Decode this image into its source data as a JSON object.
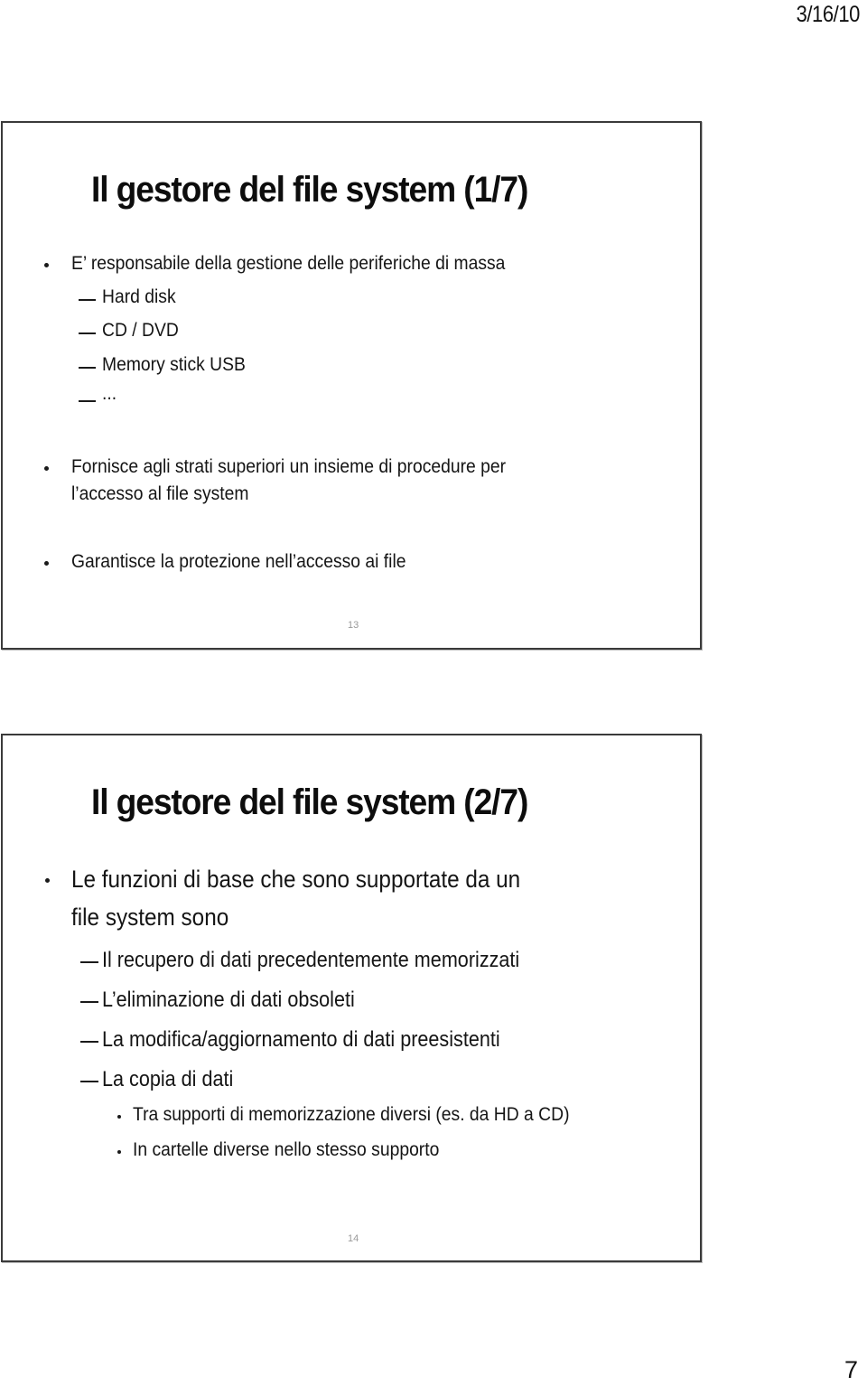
{
  "page": {
    "date": "3/16/10",
    "page_number": "7"
  },
  "slides": [
    {
      "number": "13",
      "title": "Il gestore del file system (1/7)",
      "bullets": [
        {
          "text": "E’ responsabile della gestione delle periferiche di massa",
          "sub": [
            "Hard disk",
            "CD / DVD",
            "Memory stick USB",
            "..."
          ]
        },
        {
          "text_lines": [
            "Fornisce agli strati superiori un insieme di procedure per",
            "l’accesso al file system"
          ]
        },
        {
          "text": "Garantisce la protezione nell’accesso ai file"
        }
      ]
    },
    {
      "number": "14",
      "title": "Il gestore del file system (2/7)",
      "bullets": [
        {
          "text_lines": [
            "Le funzioni di base che sono supportate da un",
            "file system sono"
          ],
          "sub": [
            "Il recupero di dati precedentemente memorizzati",
            "L’eliminazione di dati obsoleti",
            "La modifica/aggiornamento di dati preesistenti",
            "La copia di dati"
          ],
          "subsub": [
            "Tra supporti di memorizzazione diversi (es. da HD a CD)",
            "In cartelle diverse nello stesso supporto"
          ]
        }
      ]
    }
  ]
}
